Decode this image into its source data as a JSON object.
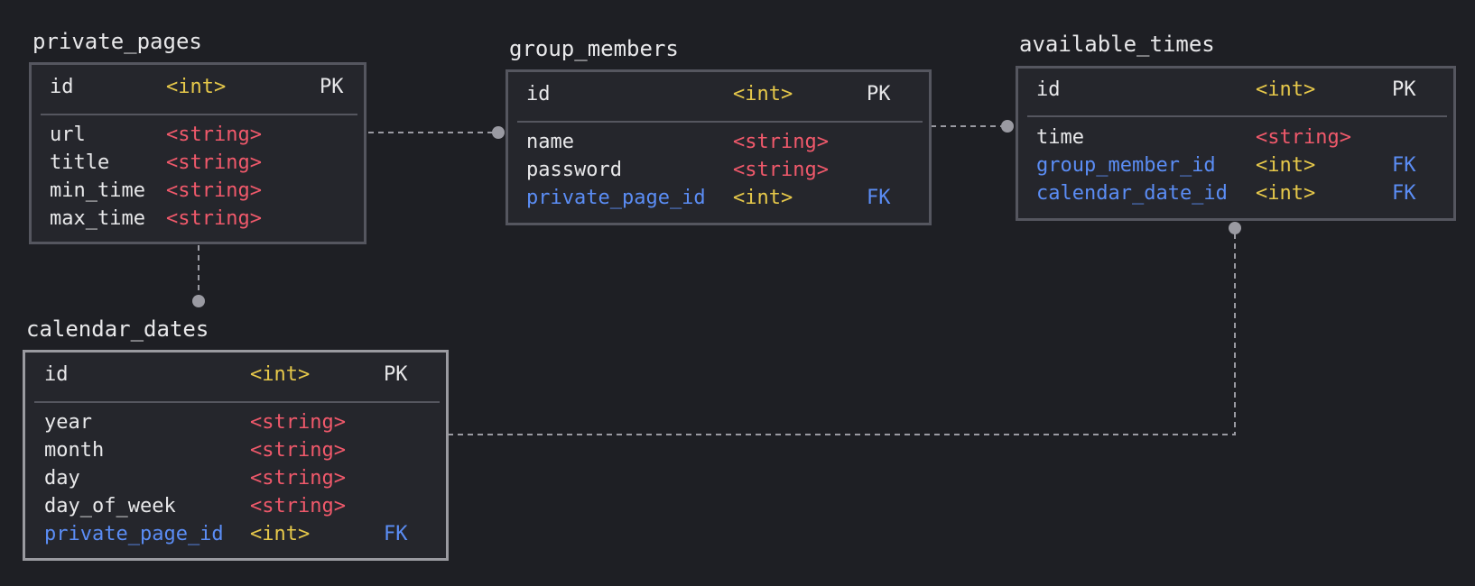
{
  "entities": {
    "private_pages": {
      "name": "private_pages",
      "fields": [
        {
          "name": "id",
          "type": "<int>",
          "key": "PK"
        },
        {
          "name": "url",
          "type": "<string>",
          "key": ""
        },
        {
          "name": "title",
          "type": "<string>",
          "key": ""
        },
        {
          "name": "min_time",
          "type": "<string>",
          "key": ""
        },
        {
          "name": "max_time",
          "type": "<string>",
          "key": ""
        }
      ]
    },
    "group_members": {
      "name": "group_members",
      "fields": [
        {
          "name": "id",
          "type": "<int>",
          "key": "PK"
        },
        {
          "name": "name",
          "type": "<string>",
          "key": ""
        },
        {
          "name": "password",
          "type": "<string>",
          "key": ""
        },
        {
          "name": "private_page_id",
          "type": "<int>",
          "key": "FK"
        }
      ]
    },
    "available_times": {
      "name": "available_times",
      "fields": [
        {
          "name": "id",
          "type": "<int>",
          "key": "PK"
        },
        {
          "name": "time",
          "type": "<string>",
          "key": ""
        },
        {
          "name": "group_member_id",
          "type": "<int>",
          "key": "FK"
        },
        {
          "name": "calendar_date_id",
          "type": "<int>",
          "key": "FK"
        }
      ]
    },
    "calendar_dates": {
      "name": "calendar_dates",
      "fields": [
        {
          "name": "id",
          "type": "<int>",
          "key": "PK"
        },
        {
          "name": "year",
          "type": "<string>",
          "key": ""
        },
        {
          "name": "month",
          "type": "<string>",
          "key": ""
        },
        {
          "name": "day",
          "type": "<string>",
          "key": ""
        },
        {
          "name": "day_of_week",
          "type": "<string>",
          "key": ""
        },
        {
          "name": "private_page_id",
          "type": "<int>",
          "key": "FK"
        }
      ]
    }
  },
  "colors": {
    "background": "#1e1f24",
    "box_fill": "#25262c",
    "box_border": "#55565f",
    "box_border_selected": "#9a9aa0",
    "text": "#e8e8ea",
    "int_type": "#e6c84a",
    "string_type": "#f0596b",
    "foreign_key": "#5b8df5",
    "connector": "#9a9aa2"
  }
}
